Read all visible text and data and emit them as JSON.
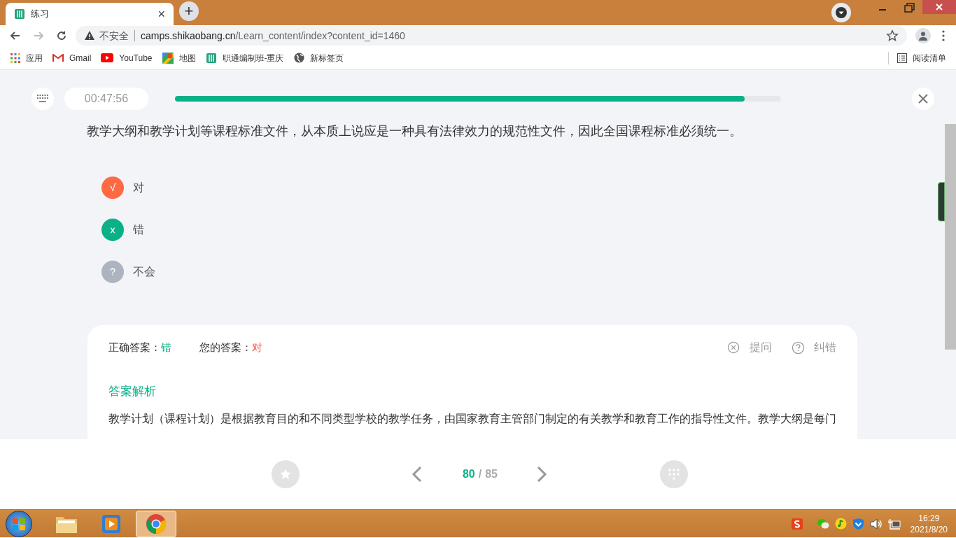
{
  "browser": {
    "tab": {
      "title": "练习",
      "close": "×"
    },
    "new_tab": "+",
    "address": {
      "security": "不安全",
      "host": "camps.shikaobang.cn",
      "path": "/Learn_content/index?content_id=1460"
    },
    "bookmarks": [
      {
        "kind": "apps",
        "label": "应用"
      },
      {
        "kind": "gmail",
        "label": "Gmail"
      },
      {
        "kind": "youtube",
        "label": "YouTube"
      },
      {
        "kind": "maps",
        "label": "地图"
      },
      {
        "kind": "book",
        "label": "职通编制班-重庆"
      },
      {
        "kind": "globe",
        "label": "新标签页"
      }
    ],
    "reading_list": "阅读清单"
  },
  "quiz": {
    "timer": "00:47:56",
    "progress": {
      "level": 0.94
    },
    "question": "教学大纲和教学计划等课程标准文件，从本质上说应是一种具有法律效力的规范性文件，因此全国课程标准必须统一。",
    "options": [
      {
        "mark": "√",
        "label": "对",
        "selected": true,
        "correct": false
      },
      {
        "mark": "x",
        "label": "错",
        "selected": false,
        "correct": true
      },
      {
        "mark": "?",
        "label": "不会",
        "selected": false,
        "correct": false
      }
    ],
    "result": {
      "correct_label": "正确答案：",
      "correct_value": "错",
      "yours_label": "您的答案：",
      "yours_value": "对",
      "actions": [
        {
          "kind": "ask",
          "label": "提问"
        },
        {
          "kind": "report",
          "label": "纠错"
        }
      ],
      "analysis_title": "答案解析",
      "analysis_text": "教学计划（课程计划）是根据教育目的和不同类型学校的教学任务，由国家教育主管部门制定的有关教学和教育工作的指导性文件。教学大纲是每门"
    },
    "pager": {
      "current": "80",
      "separator": "/",
      "total": "85"
    }
  },
  "taskbar": {
    "apps": [
      {
        "kind": "folder",
        "selected": false
      },
      {
        "kind": "media",
        "selected": false
      },
      {
        "kind": "chrome",
        "selected": true
      }
    ],
    "time": "16:29",
    "date": "2021/8/20"
  }
}
